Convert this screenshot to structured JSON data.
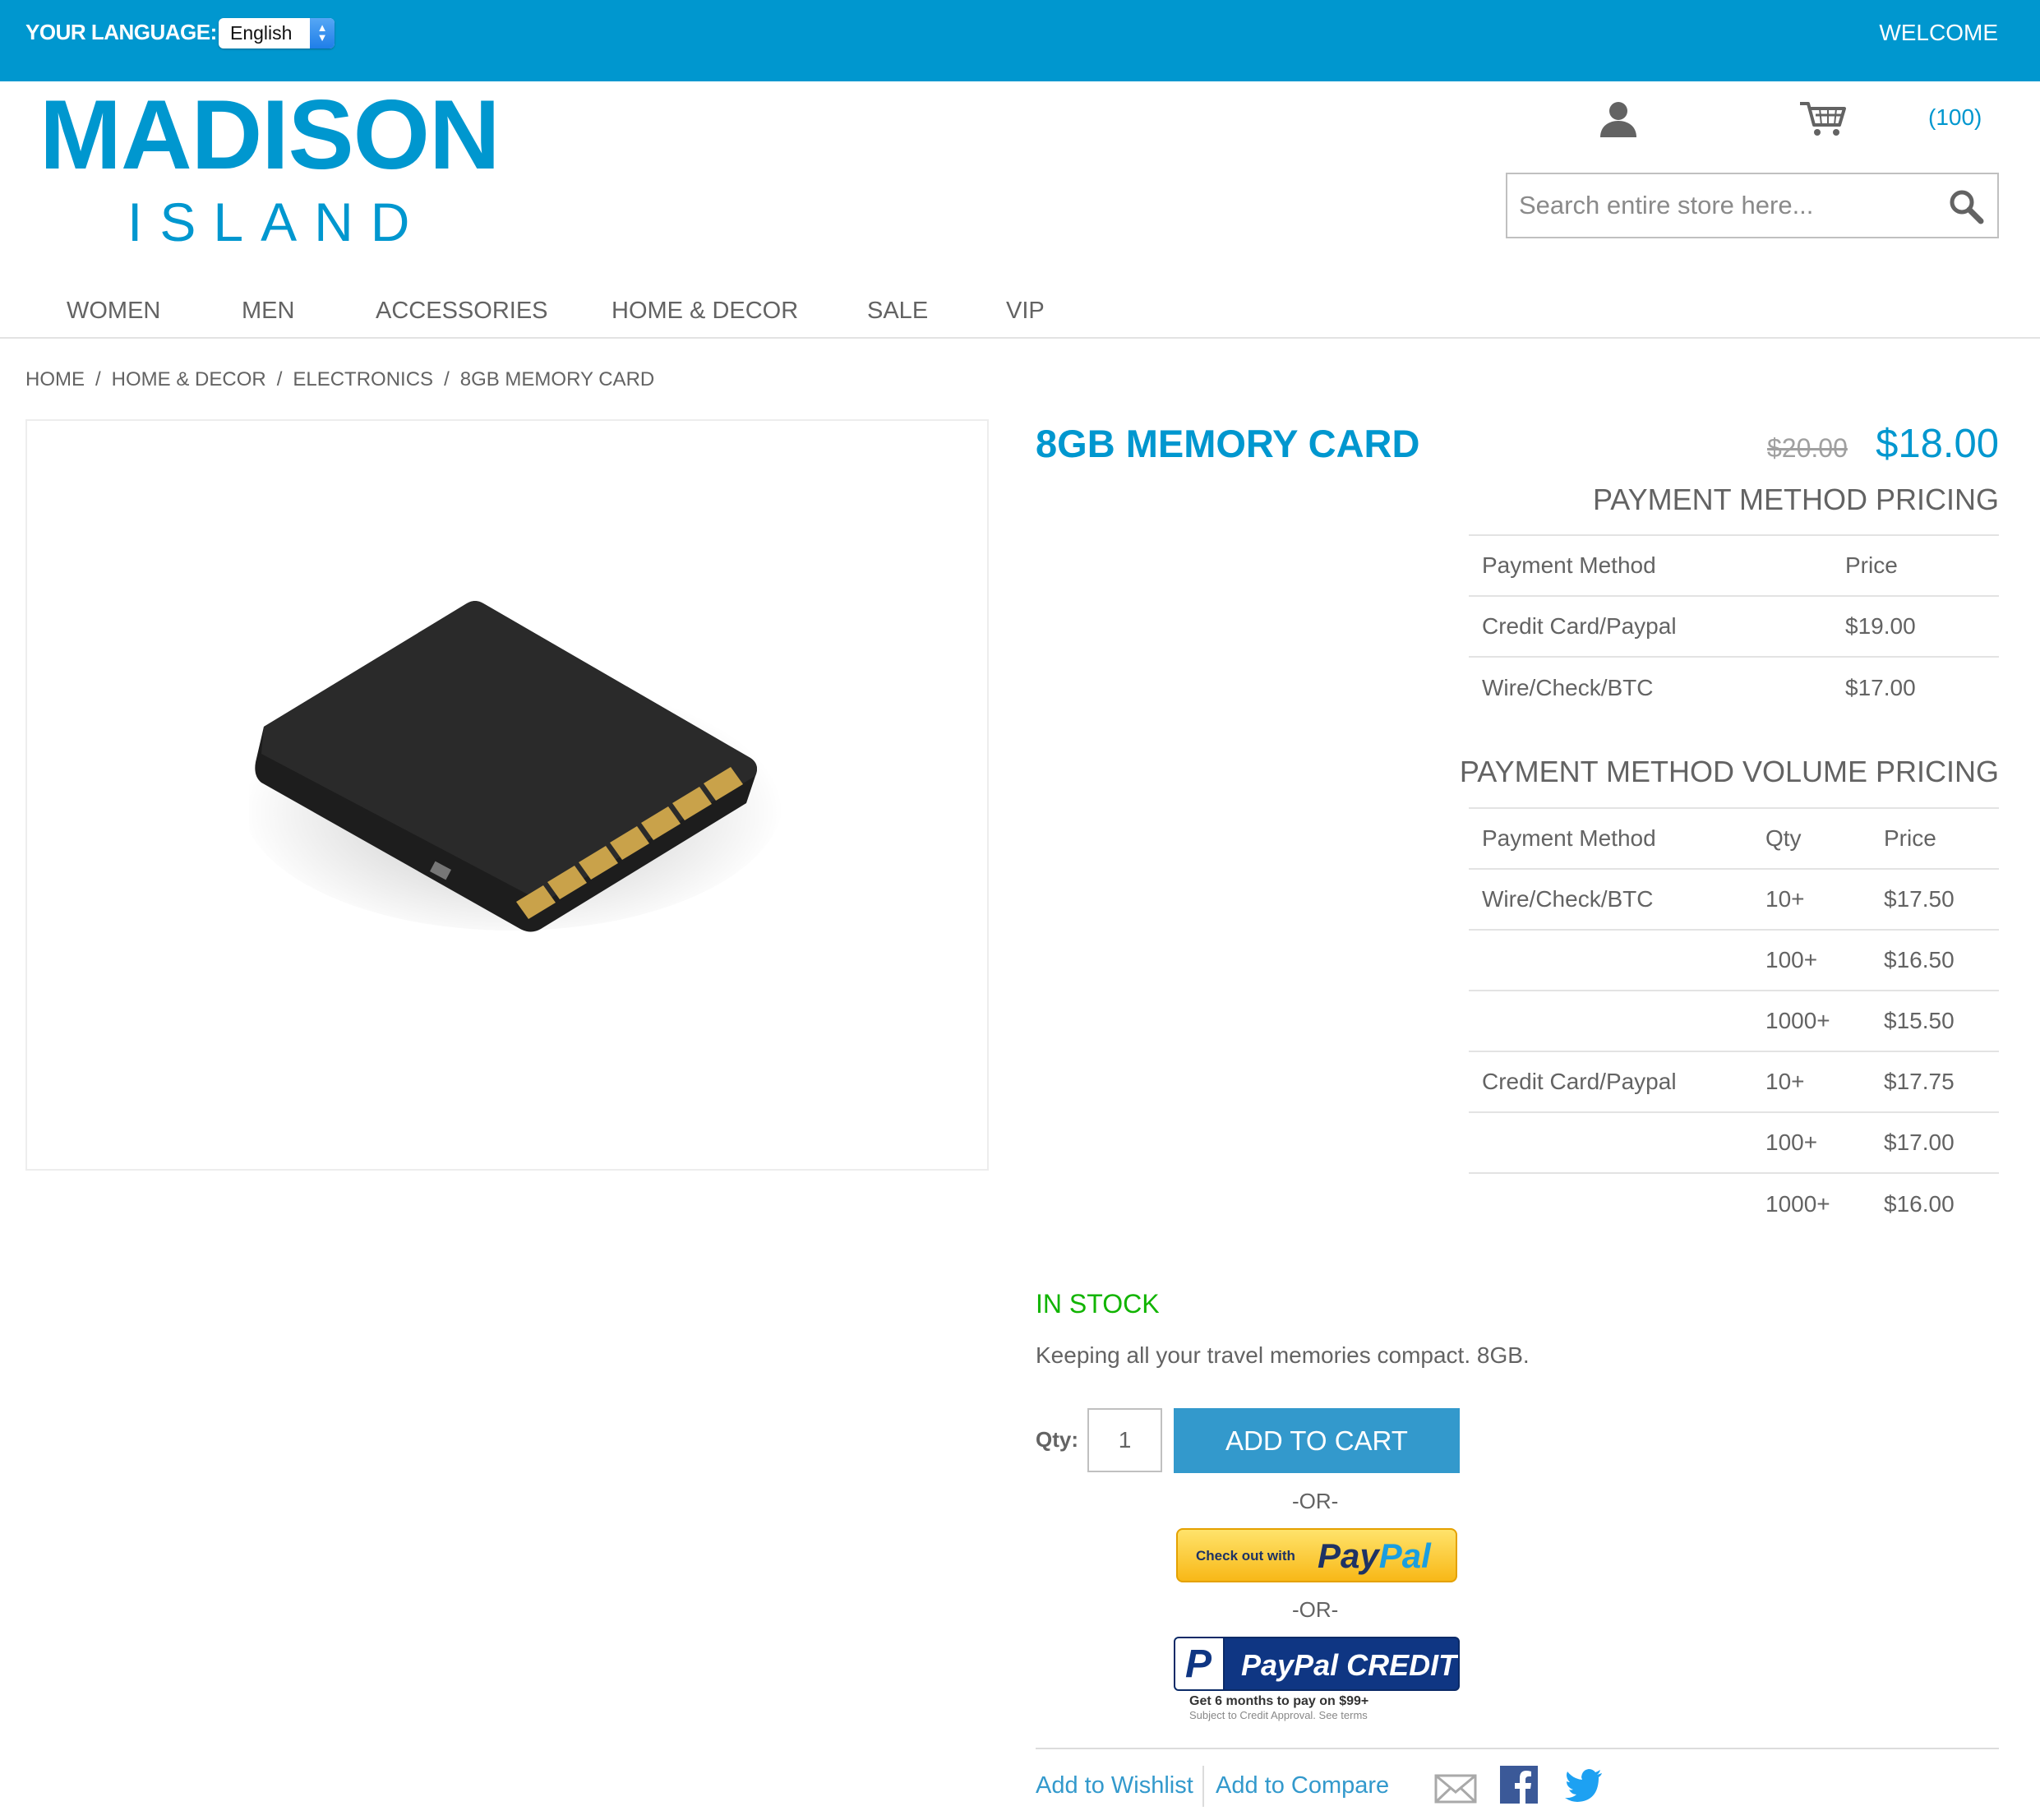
{
  "topbar": {
    "language_label": "YOUR LANGUAGE:",
    "language_selected": "English",
    "welcome": "WELCOME"
  },
  "header": {
    "logo_main": "MADISON",
    "logo_sub": "ISLAND",
    "cart_count": "(100)",
    "search_placeholder": "Search entire store here..."
  },
  "nav": {
    "items": [
      "WOMEN",
      "MEN",
      "ACCESSORIES",
      "HOME & DECOR",
      "SALE",
      "VIP"
    ]
  },
  "breadcrumb": {
    "items": [
      "HOME",
      "HOME & DECOR",
      "ELECTRONICS",
      "8GB MEMORY CARD"
    ],
    "separator": "/"
  },
  "product": {
    "name": "8GB MEMORY CARD",
    "old_price": "$20.00",
    "special_price": "$18.00",
    "stock": "IN STOCK",
    "description": "Keeping all your travel memories compact. 8GB.",
    "qty_label": "Qty:",
    "qty_value": "1",
    "add_to_cart": "ADD TO CART",
    "or_text": "-OR-",
    "paypal_checkout_small": "Check out with",
    "paypal_pay": "Pay",
    "paypal_pal": "Pal",
    "paypal_credit_label": "PayPal CREDIT",
    "paypal_credit_note": "Get 6 months to pay on $99+",
    "paypal_credit_sub": "Subject to Credit Approval. See terms",
    "add_to_wishlist": "Add to Wishlist",
    "add_to_compare": "Add to Compare"
  },
  "payment_pricing": {
    "heading": "PAYMENT METHOD PRICING",
    "headers": [
      "Payment Method",
      "Price"
    ],
    "rows": [
      [
        "Credit Card/Paypal",
        "$19.00"
      ],
      [
        "Wire/Check/BTC",
        "$17.00"
      ]
    ]
  },
  "volume_pricing": {
    "heading": "PAYMENT METHOD VOLUME PRICING",
    "headers": [
      "Payment Method",
      "Qty",
      "Price"
    ],
    "rows": [
      [
        "Wire/Check/BTC",
        "10+",
        "$17.50"
      ],
      [
        "",
        "100+",
        "$16.50"
      ],
      [
        "",
        "1000+",
        "$15.50"
      ],
      [
        "Credit Card/Paypal",
        "10+",
        "$17.75"
      ],
      [
        "",
        "100+",
        "$17.00"
      ],
      [
        "",
        "1000+",
        "$16.00"
      ]
    ]
  },
  "colors": {
    "brand_blue": "#0097cf",
    "button_blue": "#3399cc",
    "in_stock_green": "#11b400"
  },
  "icons": {
    "account": "account-icon",
    "cart": "cart-icon",
    "search": "search-icon",
    "email": "email-icon",
    "facebook": "facebook-icon",
    "twitter": "twitter-icon"
  }
}
